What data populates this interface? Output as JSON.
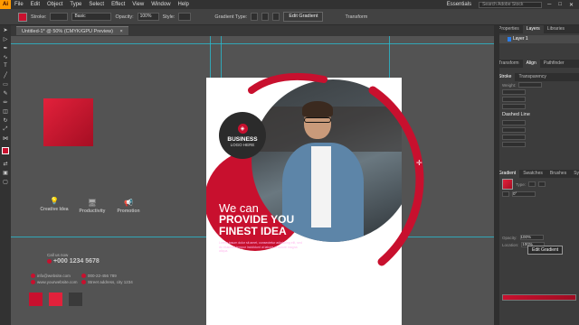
{
  "menubar": {
    "logo": "Ai",
    "items": [
      "File",
      "Edit",
      "Object",
      "Type",
      "Select",
      "Effect",
      "View",
      "Window",
      "Help"
    ],
    "workspace": "Essentials",
    "search_placeholder": "Search Adobe Stock"
  },
  "control_bar": {
    "fill_color": "#c8102e",
    "stroke_label": "Stroke:",
    "stroke_value": "",
    "brush_label": "Basic",
    "opacity_label": "Opacity:",
    "opacity_value": "100%",
    "style_label": "Style:",
    "gradient_type_label": "Gradient Type:",
    "edit_gradient_label": "Edit Gradient",
    "transform_label": "Transform"
  },
  "document_tab": {
    "title": "Untitled-1* @ 50% (CMYK/GPU Preview)",
    "close": "×"
  },
  "canvas_left": {
    "features": [
      "Creative Idea",
      "Productivity",
      "Promotion"
    ],
    "phone_label": "Call us now",
    "phone_number": "+000 1234 5678",
    "contacts": [
      "info@website.com",
      "www.yourwebsite.com",
      "000-22-456 789",
      "Street address, city 1234"
    ],
    "swatch_colors": [
      "#c8102e",
      "#e2213b",
      "#3a3a3a"
    ]
  },
  "artboard": {
    "logo_title": "BUSINESS",
    "logo_subtitle": "LOGO HERE",
    "headline_line1": "We can",
    "headline_line2": "PROVIDE YOU",
    "headline_line3": "FINEST IDEA",
    "body_text": "Lorem ipsum dolor sit amet, consectetur adipiscing elit, sed do eiusmod tempor incididunt ut labore et dolore magna aliqua."
  },
  "right_panel": {
    "top_tabs": [
      "Properties",
      "Layers",
      "Libraries"
    ],
    "layer_name": "Layer 1",
    "mid_tabs": [
      "Transform",
      "Align",
      "Pathfinder"
    ],
    "stroke_tabs": [
      "Stroke",
      "Transparency"
    ],
    "weight_label": "Weight:",
    "dashed_line": "Dashed Line",
    "gradient_tabs": [
      "Gradient",
      "Swatches",
      "Brushes",
      "Symbols"
    ],
    "type_label": "Type:",
    "tooltip": "Edit Gradient",
    "angle_value": "0°",
    "opacity_label": "Opacity:",
    "opacity_value": "100%",
    "location_label": "Location:",
    "location_value": "100%"
  }
}
